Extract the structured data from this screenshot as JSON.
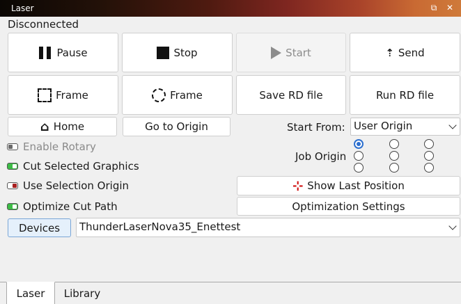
{
  "window": {
    "title": "Laser",
    "restore_glyph": "⧉",
    "close_glyph": "✕"
  },
  "status": "Disconnected",
  "buttons": {
    "pause": "Pause",
    "stop": "Stop",
    "start": "Start",
    "send": "Send",
    "frame_rect": "Frame",
    "frame_circle": "Frame",
    "save_rd": "Save RD file",
    "run_rd": "Run RD file",
    "home": "Home",
    "go_to_origin": "Go to Origin",
    "show_last_position": "Show Last Position",
    "optimization_settings": "Optimization Settings",
    "devices": "Devices"
  },
  "icons": {
    "send": "⇡",
    "home": "⌂",
    "crosshair": "⊹"
  },
  "start_from": {
    "label": "Start From:",
    "value": "User Origin"
  },
  "job_origin": {
    "label": "Job Origin",
    "selected_index": 0
  },
  "options": {
    "enable_rotary": {
      "label": "Enable Rotary",
      "state": "off",
      "enabled": false
    },
    "cut_selected_graphics": {
      "label": "Cut Selected Graphics",
      "state": "on"
    },
    "use_selection_origin": {
      "label": "Use Selection Origin",
      "state": "off"
    },
    "optimize_cut_path": {
      "label": "Optimize Cut Path",
      "state": "on"
    }
  },
  "device_select": {
    "value": "ThunderLaserNova35_Enettest"
  },
  "tabs": [
    {
      "label": "Laser",
      "active": true
    },
    {
      "label": "Library",
      "active": false
    }
  ],
  "colors": {
    "toggle_on": "#3cbc45",
    "toggle_off_red": "#a82020",
    "radio_selected": "#2c6fcf",
    "devices_bg": "#e5f0fb",
    "crosshair_red": "#d01010"
  }
}
